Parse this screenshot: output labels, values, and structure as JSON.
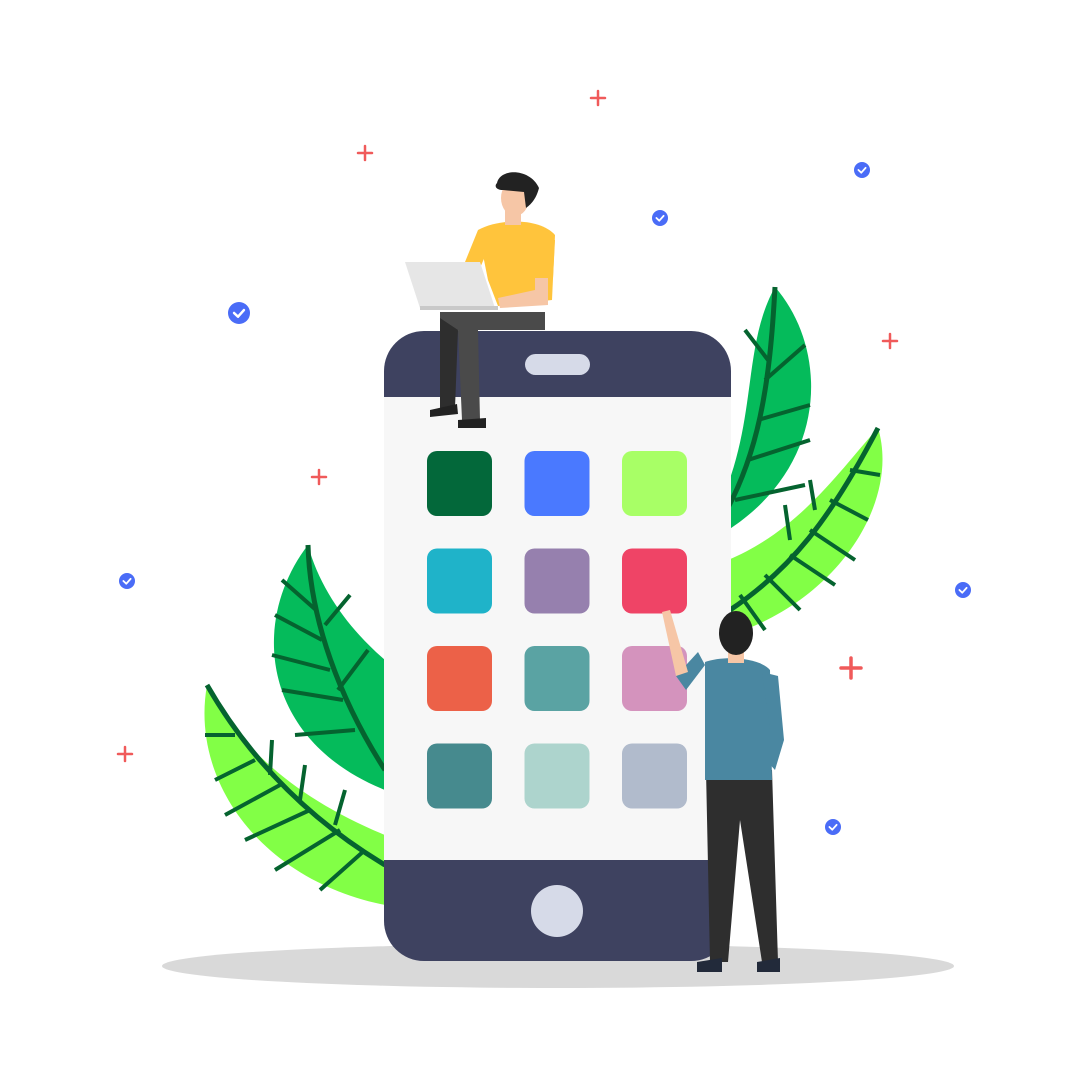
{
  "colors": {
    "background": "#ffffff",
    "phone_frame": "#3e4260",
    "phone_screen": "#f7f7f7",
    "phone_speaker": "#d6dae8",
    "phone_home_button": "#d6dae8",
    "shadow": "#d9d9d9",
    "leaf_dark_green": "#05bb5b",
    "leaf_light_green": "#82ff46",
    "leaf_vein": "#05632f",
    "plus_sign": "#f05a5a",
    "check_badge": "#4a6cf7"
  },
  "app_grid": {
    "columns": 3,
    "rows": 4,
    "tiles": [
      {
        "color": "#03683a"
      },
      {
        "color": "#4a79ff"
      },
      {
        "color": "#a8ff66"
      },
      {
        "color": "#1fb3c9"
      },
      {
        "color": "#9680ae"
      },
      {
        "color": "#ef4466"
      },
      {
        "color": "#ec6148"
      },
      {
        "color": "#5aa3a3"
      },
      {
        "color": "#d493bd"
      },
      {
        "color": "#468a8e"
      },
      {
        "color": "#add4cd"
      },
      {
        "color": "#b1bbcc"
      }
    ]
  },
  "decorations": {
    "plus_icon": "plus-icon",
    "check_icon": "check-badge-icon"
  },
  "people": {
    "sitting_person": {
      "shirt": "#ffc43c",
      "pants": "#4a4a4a",
      "skin": "#f6c6a6",
      "hair": "#222222",
      "laptop": "#e6e6e6"
    },
    "standing_person": {
      "shirt": "#4a87a1",
      "pants": "#2e2e2e",
      "skin": "#f6c6a6",
      "hair": "#222222"
    }
  }
}
